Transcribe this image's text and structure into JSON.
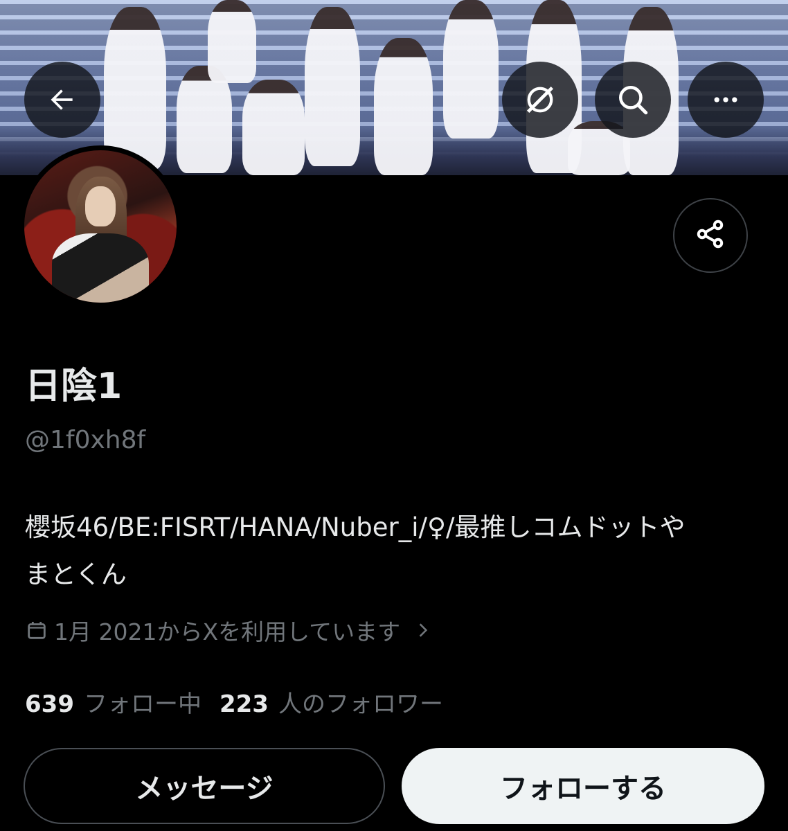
{
  "header": {
    "back_icon": "arrow-left-icon",
    "grok_icon": "grok-icon",
    "search_icon": "search-icon",
    "more_icon": "more-horizontal-icon"
  },
  "profile": {
    "display_name": "日陰1",
    "handle": "@1f0xh8f",
    "bio_line1": "櫻坂46/BE:FISRT/HANA/Nuber_i/♀/最推しコムドットや",
    "bio_line2": "まとくん",
    "joined": "1月 2021からXを利用しています",
    "joined_icon": "calendar-icon",
    "joined_chevron": "chevron-right-icon",
    "share_icon": "share-icon"
  },
  "stats": {
    "following_count": "639",
    "following_label": "フォロー中",
    "followers_count": "223",
    "followers_label": "人のフォロワー"
  },
  "actions": {
    "message_label": "メッセージ",
    "follow_label": "フォローする"
  },
  "colors": {
    "background": "#000000",
    "primary_text": "#e7e9ea",
    "secondary_text": "#71767b",
    "follow_button_bg": "#eff3f4"
  }
}
